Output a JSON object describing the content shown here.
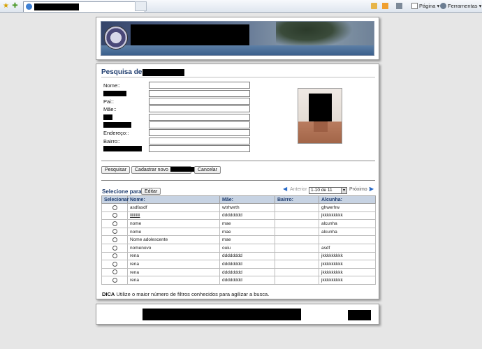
{
  "browser": {
    "tab_title": "",
    "page_menu": "Página",
    "tools_menu": "Ferramentas"
  },
  "form": {
    "title": "Pesquisa de",
    "fields": [
      {
        "label": "Nome::",
        "value": ""
      },
      {
        "label": "",
        "value": ""
      },
      {
        "label": "Pai::",
        "value": ""
      },
      {
        "label": "Mãe::",
        "value": ""
      },
      {
        "label": "",
        "value": ""
      },
      {
        "label": "",
        "value": ""
      },
      {
        "label": "Endereço::",
        "value": ""
      },
      {
        "label": "Bairro::",
        "value": ""
      },
      {
        "label": "::",
        "value": ""
      }
    ],
    "buttons": {
      "search": "Pesquisar",
      "register": "Cadastrar novo",
      "cancel": "Cancelar"
    }
  },
  "results": {
    "select_for": "Selecione para:",
    "edit_button": "Editar",
    "prev": "Anterior",
    "page_select": "1-10 de 11",
    "next": "Próximo",
    "columns": [
      "Selecionar",
      "Nome:",
      "Mãe:",
      "Bairro:",
      "Alcunha:"
    ],
    "rows": [
      {
        "nome": "asdfasdf",
        "mae": "wtrhwrth",
        "bairro": "",
        "alcunha": "ghwerhw"
      },
      {
        "nome": "iiiiiiiiii",
        "mae": "dddddddd",
        "bairro": "",
        "alcunha": "jkkkkkkkkk"
      },
      {
        "nome": "nome",
        "mae": "mae",
        "bairro": "",
        "alcunha": "alcunha"
      },
      {
        "nome": "nome",
        "mae": "mae",
        "bairro": "",
        "alcunha": "alcunha"
      },
      {
        "nome": "Nome adolescente",
        "mae": "mae",
        "bairro": "",
        "alcunha": ""
      },
      {
        "nome": "nomenovo",
        "mae": "ouiu",
        "bairro": "",
        "alcunha": "asdf"
      },
      {
        "nome": "rena",
        "mae": "dddddddd",
        "bairro": "",
        "alcunha": "jkkkkkkkkk"
      },
      {
        "nome": "rena",
        "mae": "dddddddd",
        "bairro": "",
        "alcunha": "jkkkkkkkkk"
      },
      {
        "nome": "rena",
        "mae": "dddddddd",
        "bairro": "",
        "alcunha": "jkkkkkkkkk"
      },
      {
        "nome": "rena",
        "mae": "dddddddd",
        "bairro": "",
        "alcunha": "jkkkkkkkkk"
      }
    ]
  },
  "tip": {
    "label": "DICA",
    "text": "Utilize o maior número de filtros conhecidos para agilizar a busca."
  },
  "colors": {
    "accent": "#1e3c6e",
    "table_header": "#c7d3e3"
  }
}
